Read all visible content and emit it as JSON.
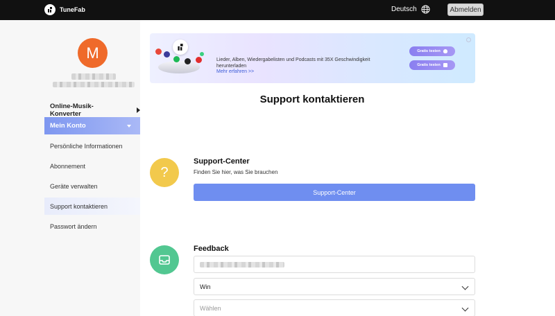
{
  "header": {
    "brand": "TuneFab",
    "language": "Deutsch",
    "logout_label": "Abmelden"
  },
  "sidebar": {
    "avatar_letter": "M",
    "section_label": "Online-Musik-Konverter",
    "active_label": "Mein Konto",
    "items": [
      {
        "label": "Persönliche Informationen"
      },
      {
        "label": "Abonnement"
      },
      {
        "label": "Geräte verwalten"
      },
      {
        "label": "Support kontaktieren"
      },
      {
        "label": "Passwort ändern"
      }
    ]
  },
  "banner": {
    "text": "Lieder, Alben, Wiedergabelisten und Podcasts mit 35X Geschwindigkeit herunterladen",
    "link": "Mehr erfahren >>",
    "btn_mac": "Gratis testen",
    "btn_win": "Gratis testen"
  },
  "main": {
    "title": "Support kontaktieren",
    "support": {
      "title": "Support-Center",
      "subtitle": "Finden Sie hier, was Sie brauchen",
      "button": "Support-Center"
    },
    "feedback": {
      "title": "Feedback",
      "os_value": "Win",
      "select_placeholder": "Wählen"
    }
  },
  "colors": {
    "avatar": "#ef6a2a",
    "accent": "#6f8ef0",
    "support_icon": "#f2c94c",
    "feedback_icon": "#52c791"
  }
}
